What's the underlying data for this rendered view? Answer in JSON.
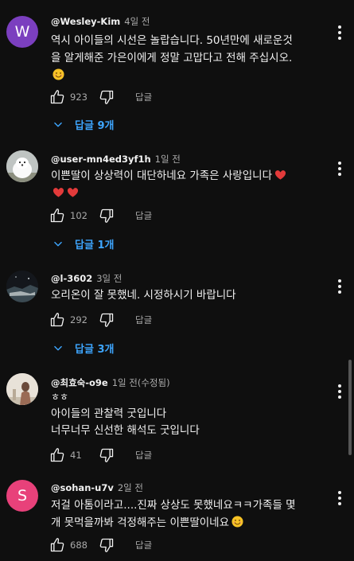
{
  "colors": {
    "background": "#0f0f0f",
    "text": "#f1f1f1",
    "secondary": "#aaaaaa",
    "link": "#3ea6ff"
  },
  "comments": [
    {
      "author": "@Wesley-Kim",
      "time": "4일 전",
      "avatar_letter": "W",
      "avatar_color": "#7b3fbf",
      "lines": [
        "역시 아이들의 시선은 놀랍습니다. 50년만에 새로운것",
        "을 알게해준 가은이에게 정말 고맙다고 전해 주십시오.",
        ""
      ],
      "likes": "923",
      "reply_label": "답글",
      "replies_label": "답글 9개"
    },
    {
      "author": "@user-mn4ed3yf1h",
      "time": "1일 전",
      "avatar_icon": "white-dog-avatar",
      "lines": [
        "이쁜딸이 상상력이 대단하네요 가족은 사랑입니다",
        ""
      ],
      "likes": "102",
      "reply_label": "답글",
      "replies_label": "답글 1개"
    },
    {
      "author": "@l-3602",
      "time": "3일 전",
      "avatar_icon": "night-scene-avatar",
      "lines": [
        "오리온이 잘 못했네.  시정하시기 바랍니다"
      ],
      "likes": "292",
      "reply_label": "답글",
      "replies_label": "답글 3개"
    },
    {
      "author": "@최효숙-o9e",
      "time": "1일 전(수정됨)",
      "avatar_icon": "photo-avatar",
      "lines": [
        "ㅎㅎ",
        "아이들의 관찰력 굿입니다",
        "너무너무 신선한 해석도 굿입니다"
      ],
      "likes": "41",
      "reply_label": "답글"
    },
    {
      "author": "@sohan-u7v",
      "time": "2일 전",
      "avatar_letter": "S",
      "avatar_color": "#e8417a",
      "lines": [
        "저걸 아톰이라고....진짜 상상도 못했네요ㅋㅋ가족들 몇",
        "개 못먹을까봐 걱정해주는 이쁜딸이네요"
      ],
      "likes": "688",
      "reply_label": "답글"
    }
  ]
}
